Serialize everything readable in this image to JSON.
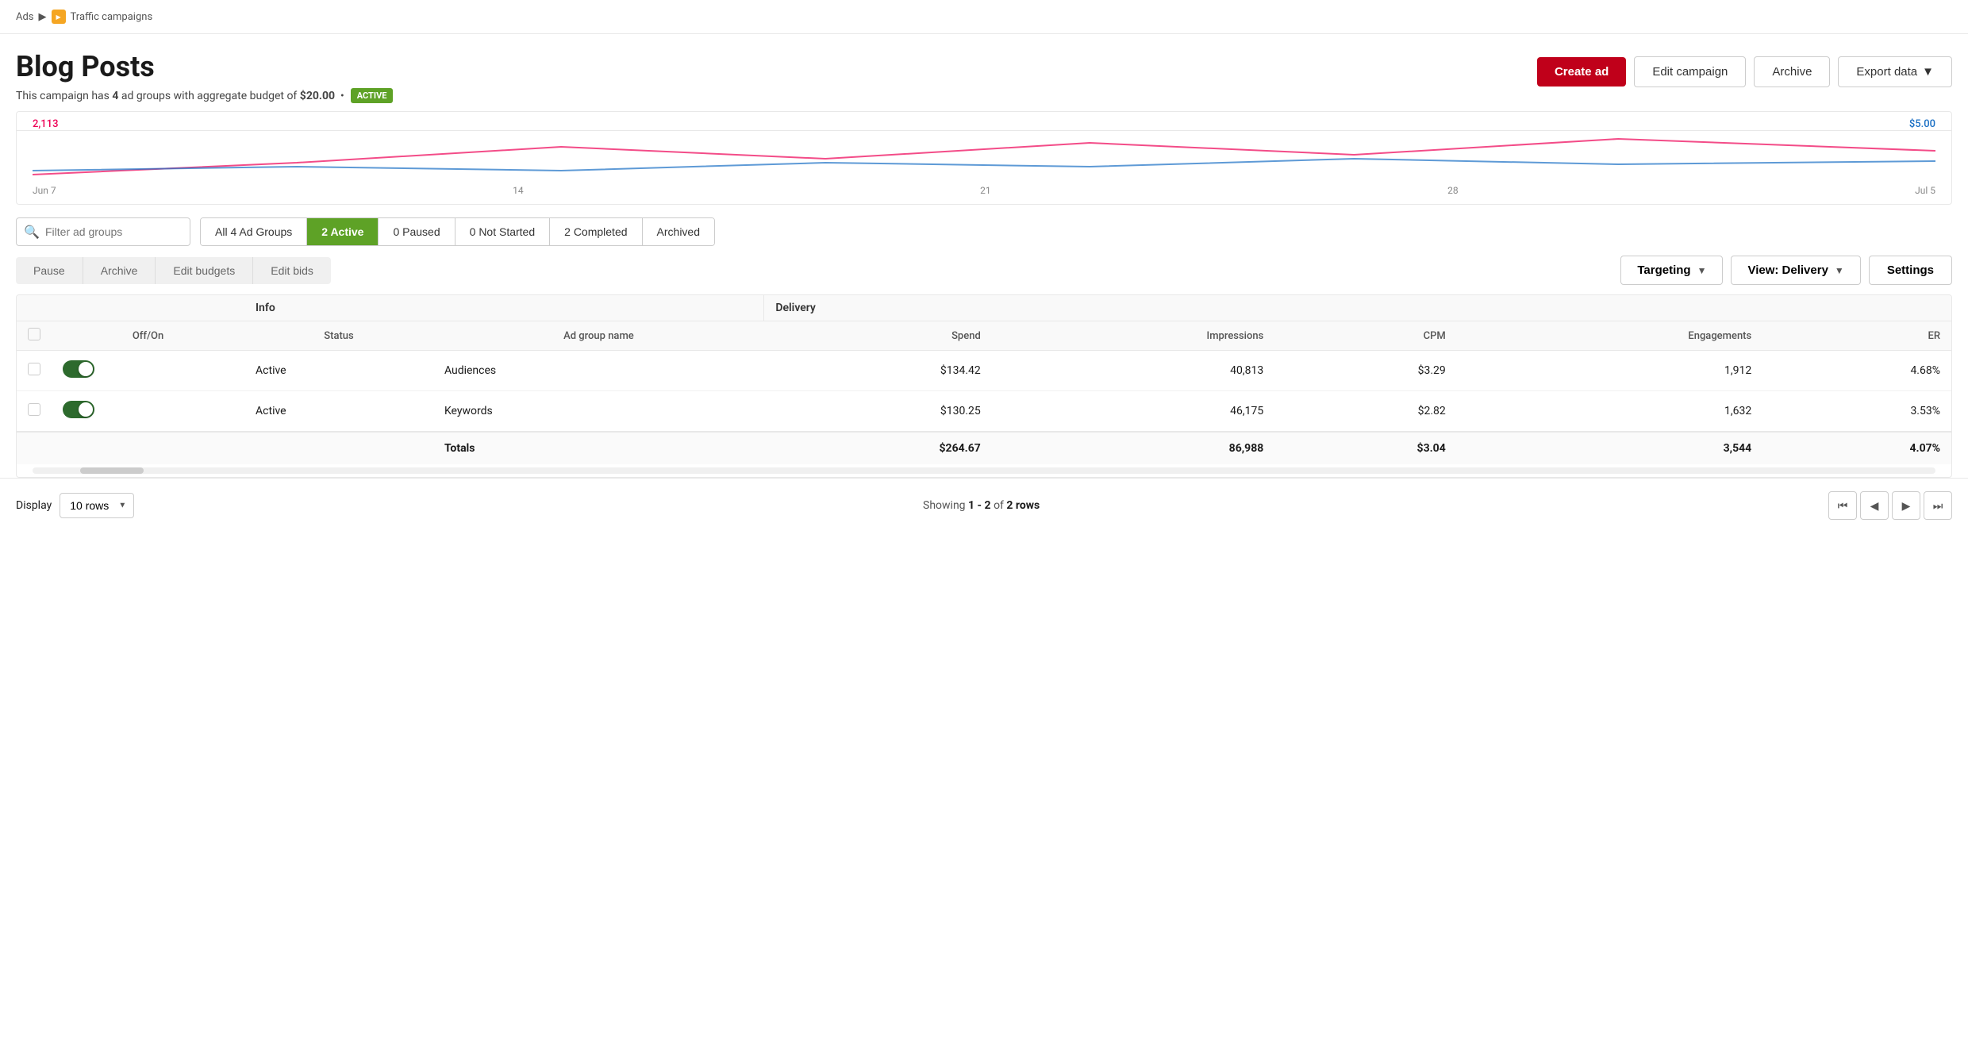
{
  "breadcrumb": {
    "parent": "Ads",
    "separator": "▶",
    "campaign_icon": "traffic-icon",
    "current": "Traffic campaigns"
  },
  "header": {
    "title": "Blog Posts",
    "subtitle_prefix": "This campaign has",
    "ad_group_count": "4",
    "subtitle_mid": "ad groups with aggregate budget of",
    "budget": "$20.00",
    "status": "ACTIVE"
  },
  "buttons": {
    "create_ad": "Create ad",
    "edit_campaign": "Edit campaign",
    "archive": "Archive",
    "export_data": "Export data"
  },
  "chart": {
    "left_value": "2,113",
    "right_value": "$5.00",
    "labels": [
      "Jun 7",
      "14",
      "21",
      "28",
      "Jul 5"
    ]
  },
  "filter": {
    "search_placeholder": "Filter ad groups",
    "tabs": [
      {
        "label": "All 4 Ad Groups",
        "active": false
      },
      {
        "label": "2 Active",
        "active": true
      },
      {
        "label": "0 Paused",
        "active": false
      },
      {
        "label": "0 Not Started",
        "active": false
      },
      {
        "label": "2 Completed",
        "active": false
      },
      {
        "label": "Archived",
        "active": false
      }
    ]
  },
  "actions": {
    "pause": "Pause",
    "archive": "Archive",
    "edit_budgets": "Edit budgets",
    "edit_bids": "Edit bids",
    "targeting": "Targeting",
    "view_delivery": "View: Delivery",
    "settings": "Settings"
  },
  "table": {
    "section_headers": {
      "info": "Info",
      "delivery": "Delivery"
    },
    "col_headers": {
      "off_on": "Off/On",
      "status": "Status",
      "ad_group_name": "Ad group name",
      "spend": "Spend",
      "impressions": "Impressions",
      "cpm": "CPM",
      "engagements": "Engagements",
      "er": "ER"
    },
    "rows": [
      {
        "status": "Active",
        "name": "Audiences",
        "spend": "$134.42",
        "impressions": "40,813",
        "cpm": "$3.29",
        "engagements": "1,912",
        "er": "4.68%"
      },
      {
        "status": "Active",
        "name": "Keywords",
        "spend": "$130.25",
        "impressions": "46,175",
        "cpm": "$2.82",
        "engagements": "1,632",
        "er": "3.53%"
      }
    ],
    "totals": {
      "label": "Totals",
      "spend": "$264.67",
      "impressions": "86,988",
      "cpm": "$3.04",
      "engagements": "3,544",
      "er": "4.07%"
    }
  },
  "footer": {
    "display_label": "Display",
    "rows_option": "10 rows",
    "showing_prefix": "Showing",
    "showing_range": "1 - 2",
    "showing_of": "of",
    "showing_count": "2 rows"
  }
}
